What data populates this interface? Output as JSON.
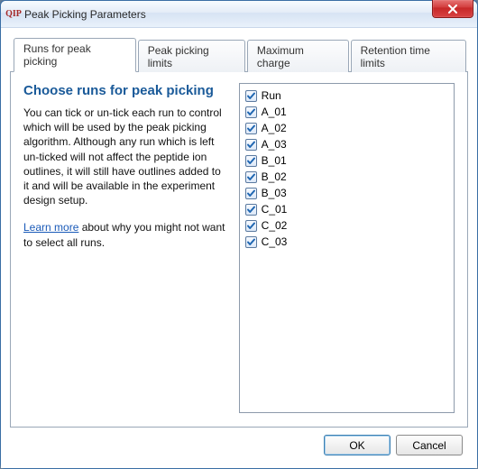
{
  "window": {
    "title": "Peak Picking Parameters",
    "app_icon_text": "QIP"
  },
  "tabs": [
    {
      "label": "Runs for peak picking",
      "active": true
    },
    {
      "label": "Peak picking limits",
      "active": false
    },
    {
      "label": "Maximum charge",
      "active": false
    },
    {
      "label": "Retention time limits",
      "active": false
    }
  ],
  "panel": {
    "heading": "Choose runs for peak picking",
    "description": "You can tick or un-tick each run to control which will be used by the peak picking algorithm. Although any run which is left un-ticked will not affect the peptide ion outlines, it will still have outlines added to it and will be available in the experiment design setup.",
    "learn_more_label": "Learn more",
    "learn_more_tail": " about why you might not want to select all runs."
  },
  "runs": [
    {
      "label": "Run",
      "checked": true
    },
    {
      "label": "A_01",
      "checked": true
    },
    {
      "label": "A_02",
      "checked": true
    },
    {
      "label": "A_03",
      "checked": true
    },
    {
      "label": "B_01",
      "checked": true
    },
    {
      "label": "B_02",
      "checked": true
    },
    {
      "label": "B_03",
      "checked": true
    },
    {
      "label": "C_01",
      "checked": true
    },
    {
      "label": "C_02",
      "checked": true
    },
    {
      "label": "C_03",
      "checked": true
    }
  ],
  "buttons": {
    "ok": "OK",
    "cancel": "Cancel"
  }
}
